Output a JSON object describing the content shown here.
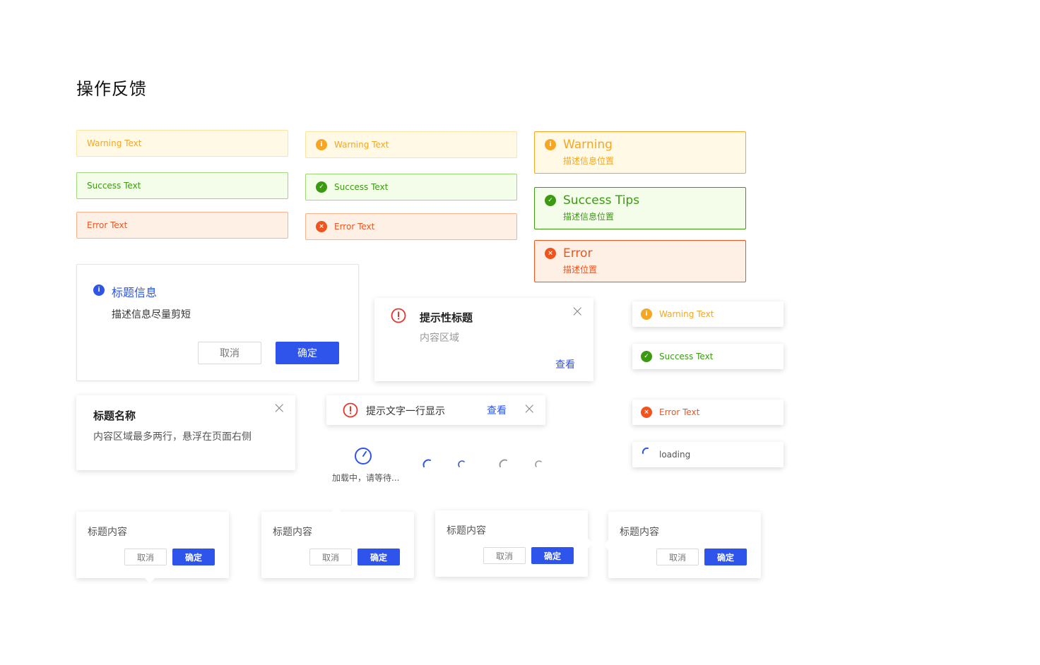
{
  "page": {
    "title": "操作反馈"
  },
  "colors": {
    "primary": "#2f54eb",
    "warning": "#f5a623",
    "success": "#3b9a12",
    "error": "#f0531c"
  },
  "alerts_plain": {
    "warning": "Warning Text",
    "success": "Success Text",
    "error": "Error Text"
  },
  "alerts_icon": {
    "warning": "Warning Text",
    "success": "Success Text",
    "error": "Error Text"
  },
  "alerts_desc": {
    "warning": {
      "title": "Warning",
      "desc": "描述信息位置"
    },
    "success": {
      "title": "Success Tips",
      "desc": "描述信息位置"
    },
    "error": {
      "title": "Error",
      "desc": "描述位置"
    }
  },
  "info_dialog": {
    "title": "标题信息",
    "desc": "描述信息尽量剪短",
    "cancel": "取消",
    "ok": "确定"
  },
  "notice_dialog": {
    "title": "提示性标题",
    "content": "内容区域",
    "link": "查看"
  },
  "notification": {
    "title": "标题名称",
    "content": "内容区域最多两行，悬浮在页面右侧"
  },
  "inline_notice": {
    "text": "提示文字一行显示",
    "link": "查看"
  },
  "loading": {
    "text": "加载中，请等待..."
  },
  "toasts": {
    "warning": "Warning Text",
    "success": "Success Text",
    "error": "Error Text",
    "loading": "loading"
  },
  "popconfirms": [
    {
      "title": "标题内容",
      "cancel": "取消",
      "ok": "确定"
    },
    {
      "title": "标题内容",
      "cancel": "取消",
      "ok": "确定"
    },
    {
      "title": "标题内容",
      "cancel": "取消",
      "ok": "确定"
    },
    {
      "title": "标题内容",
      "cancel": "取消",
      "ok": "确定"
    }
  ]
}
